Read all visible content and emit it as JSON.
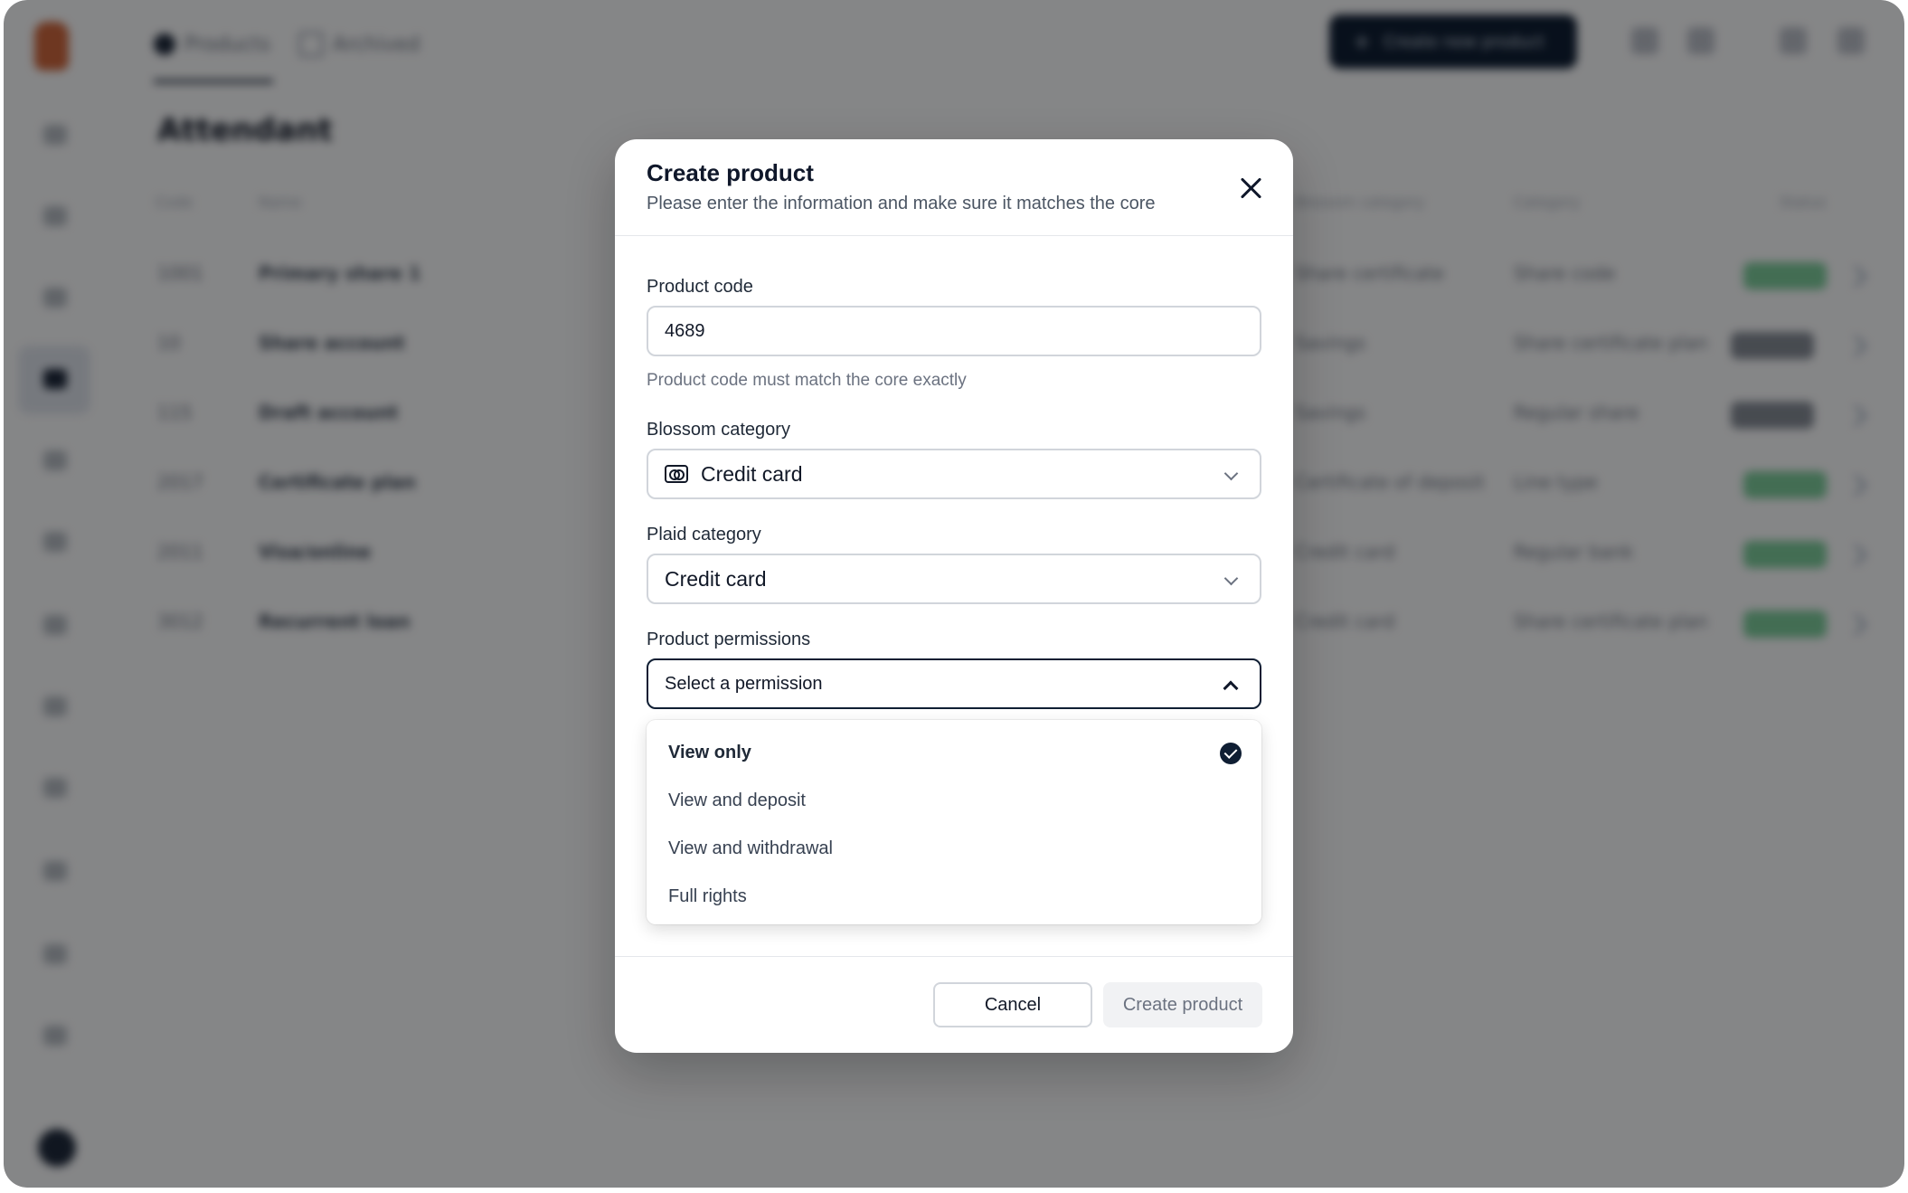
{
  "background": {
    "tabs": [
      "Products",
      "Archived"
    ],
    "page_title": "Attendant",
    "top_button_label": "Create new product",
    "table": {
      "headers": [
        "Code",
        "Name",
        "Blossom category",
        "Category",
        "Status"
      ],
      "rows": [
        [
          "1001",
          "Primary share 1",
          "Share certificate",
          "Share code"
        ],
        [
          "10",
          "Share account",
          "Savings",
          "Share certificate plan"
        ],
        [
          "115",
          "Draft account",
          "Savings",
          "Regular share"
        ],
        [
          "2017",
          "Certificate plan",
          "Certificate of deposit",
          "Line type"
        ],
        [
          "2011",
          "Visa/online",
          "Credit card",
          "Regular bank"
        ],
        [
          "3012",
          "Recurrent loan",
          "Credit card",
          "Share certificate plan"
        ]
      ]
    }
  },
  "modal": {
    "title": "Create product",
    "subtitle": "Please enter the information and make sure it matches the core",
    "product_code": {
      "label": "Product code",
      "value": "4689",
      "help": "Product code must match the core exactly"
    },
    "blossom_category": {
      "label": "Blossom category",
      "value": "Credit card",
      "icon": "credit-card-icon"
    },
    "plaid_category": {
      "label": "Plaid category",
      "value": "Credit card"
    },
    "product_permissions": {
      "label": "Product permissions",
      "placeholder": "Select a permission",
      "options": [
        "View only",
        "View and deposit",
        "View and withdrawal",
        "Full rights"
      ],
      "selected_index": 0
    },
    "cancel_label": "Cancel",
    "create_label": "Create product"
  },
  "colors": {
    "accent": "#0f1e33",
    "overlay": "rgba(0,0,0,0.45)",
    "status_green": "#16a34a"
  }
}
